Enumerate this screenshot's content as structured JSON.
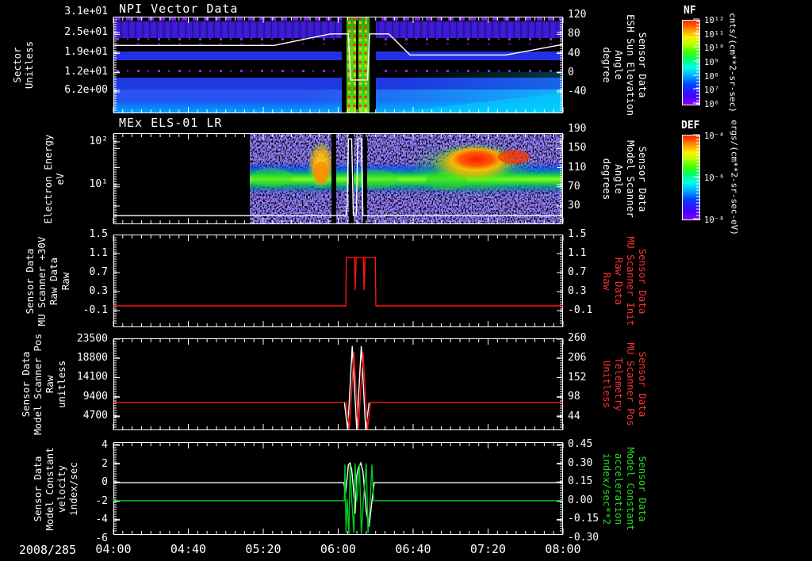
{
  "window": {
    "date_label": "2008/285"
  },
  "xaxis": {
    "tick_labels": [
      "04:00",
      "04:40",
      "05:20",
      "06:00",
      "06:40",
      "07:20",
      "08:00"
    ],
    "t_start": 4,
    "t_end": 8
  },
  "colors": {
    "red": "#ff2020",
    "green": "#00cc33",
    "white": "#ffffff"
  },
  "chart_data": [
    {
      "type": "heatmap",
      "title": "NPI Vector Data",
      "ylabel_lines": [
        "Sector",
        "Unitless"
      ],
      "yticks": [
        "3.1e+01",
        "2.5e+01",
        "1.9e+01",
        "1.2e+01",
        "6.2e+00"
      ],
      "right_axis": {
        "label_lines": [
          "Sensor Data",
          "ESH Sun Elevation",
          "Angle",
          "degree"
        ],
        "ticks": [
          "120",
          "80",
          "40",
          "0",
          "-40"
        ]
      },
      "colorbar": {
        "name": "NF",
        "ticks": [
          "10¹²",
          "10¹¹",
          "10¹⁰",
          "10⁹",
          "10⁸",
          "10⁷",
          "10⁶"
        ],
        "unit": "cnts/(cm**2-sr-sec)"
      },
      "overlay_series": [
        {
          "name": "esh-sun-elevation-angle",
          "color": "#ffffff",
          "axis": "right",
          "points": [
            [
              4.0,
              57
            ],
            [
              5.43,
              57
            ],
            [
              5.93,
              81
            ],
            [
              6.09,
              81
            ],
            [
              6.11,
              -15
            ],
            [
              6.26,
              -15
            ],
            [
              6.28,
              81
            ],
            [
              6.45,
              81
            ],
            [
              6.64,
              37
            ],
            [
              7.49,
              37
            ],
            [
              8.0,
              59
            ]
          ]
        }
      ]
    },
    {
      "type": "heatmap",
      "title": "MEx ELS-01 LR",
      "ylabel_lines": [
        "Electron Energy",
        "eV"
      ],
      "yticks": [
        "10²",
        "10¹"
      ],
      "right_axis": {
        "label_lines": [
          "Sensor Data",
          "Model Scanner",
          "Angle",
          "degrees"
        ],
        "ticks": [
          "190",
          "150",
          "110",
          "70",
          "30"
        ]
      },
      "colorbar": {
        "name": "DEF",
        "ticks": [
          "10⁻⁴",
          "10⁻⁶",
          "10⁻⁸"
        ],
        "unit": "ergs/(cm**2-sr-sec-eV)"
      },
      "overlay_series": [
        {
          "name": "model-scanner-angle",
          "color": "#ffffff",
          "axis": "right",
          "points": [
            [
              4.0,
              10
            ],
            [
              6.07,
              10
            ],
            [
              6.08,
              28
            ],
            [
              6.09,
              170
            ],
            [
              6.12,
              170
            ],
            [
              6.135,
              10
            ],
            [
              6.16,
              10
            ],
            [
              6.175,
              170
            ],
            [
              6.205,
              170
            ],
            [
              6.22,
              10
            ],
            [
              8.0,
              10
            ]
          ]
        }
      ]
    },
    {
      "type": "line",
      "title": "",
      "ylabel_lines": [
        "Sensor Data",
        "MU Scanner +30V",
        "Raw Data",
        "Raw"
      ],
      "yticks": [
        "1.5",
        "1.1",
        "0.7",
        "0.3",
        "-0.1"
      ],
      "right_axis": {
        "label_lines": [
          "Sensor Data",
          "MU Scanner Init",
          "Raw Data",
          "Raw"
        ],
        "label_color": "#ff3030",
        "ticks": [
          "1.5",
          "1.1",
          "0.7",
          "0.3",
          "-0.1"
        ]
      },
      "series": [
        {
          "name": "mu-scanner-30v-raw",
          "color": "#ff1515",
          "axis": "left",
          "points": [
            [
              4.0,
              0.0
            ],
            [
              6.068,
              0.0
            ],
            [
              6.072,
              1.02
            ],
            [
              6.145,
              1.02
            ],
            [
              6.15,
              0.33
            ],
            [
              6.16,
              1.02
            ],
            [
              6.225,
              1.02
            ],
            [
              6.23,
              0.33
            ],
            [
              6.24,
              1.02
            ],
            [
              6.33,
              1.02
            ],
            [
              6.335,
              0.0
            ],
            [
              8.0,
              0.0
            ]
          ]
        }
      ]
    },
    {
      "type": "line",
      "title": "",
      "ylabel_lines": [
        "Sensor Data",
        "Model Scanner Pos",
        "Raw",
        "unitless"
      ],
      "yticks": [
        "23500",
        "18800",
        "14100",
        "9400",
        "4700"
      ],
      "right_axis": {
        "label_lines": [
          "Sensor Data",
          "MU Scanner Pos",
          "Telemetry",
          "Unitless"
        ],
        "label_color": "#ff3030",
        "ticks": [
          "260",
          "206",
          "152",
          "98",
          "44"
        ]
      },
      "series": [
        {
          "name": "model-scanner-pos",
          "color": "#ffffff",
          "axis": "left",
          "points": [
            [
              6.055,
              8000
            ],
            [
              6.085,
              1300
            ],
            [
              6.125,
              21800
            ],
            [
              6.165,
              1300
            ],
            [
              6.205,
              21800
            ],
            [
              6.245,
              1300
            ],
            [
              6.275,
              8000
            ]
          ]
        },
        {
          "name": "mu-scanner-pos-telemetry",
          "color": "#ff1515",
          "axis": "left",
          "points": [
            [
              4.0,
              8000
            ],
            [
              6.07,
              8000
            ],
            [
              6.1,
              1500
            ],
            [
              6.14,
              20300
            ],
            [
              6.18,
              1500
            ],
            [
              6.22,
              20300
            ],
            [
              6.26,
              1500
            ],
            [
              6.29,
              8000
            ],
            [
              8.0,
              8000
            ]
          ]
        }
      ]
    },
    {
      "type": "line",
      "title": "",
      "ylabel_lines": [
        "Sensor Data",
        "Model Constant",
        "velocity",
        "index/sec"
      ],
      "yticks": [
        "4",
        "2",
        "0",
        "-2",
        "-4",
        "-6"
      ],
      "right_axis": {
        "label_lines": [
          "Sensor Data",
          "Model Constant",
          "acceleration",
          "index/sec**2"
        ],
        "label_color": "#22dd22",
        "ticks": [
          "0.45",
          "0.30",
          "0.15",
          "0.00",
          "-0.15",
          "-0.30"
        ]
      },
      "series": [
        {
          "name": "model-constant-velocity",
          "color": "#ffffff",
          "axis": "left",
          "points": [
            [
              4.0,
              0
            ],
            [
              6.05,
              0
            ],
            [
              6.065,
              -1.2
            ],
            [
              6.08,
              0.5
            ],
            [
              6.09,
              1.9
            ],
            [
              6.105,
              2.1
            ],
            [
              6.12,
              1.4
            ],
            [
              6.135,
              -0.5
            ],
            [
              6.15,
              -3.3
            ],
            [
              6.165,
              0.8
            ],
            [
              6.18,
              1.6
            ],
            [
              6.2,
              2.1
            ],
            [
              6.22,
              1.2
            ],
            [
              6.235,
              -0.8
            ],
            [
              6.25,
              -3.1
            ],
            [
              6.275,
              -4.7
            ],
            [
              6.3,
              -2.0
            ],
            [
              6.32,
              0
            ],
            [
              8.0,
              0
            ]
          ]
        },
        {
          "name": "model-constant-acceleration",
          "color": "#00cc22",
          "axis": "right",
          "points": [
            [
              4.0,
              0
            ],
            [
              6.055,
              0
            ],
            [
              6.06,
              0.29
            ],
            [
              6.07,
              -0.26
            ],
            [
              6.08,
              0.01
            ],
            [
              6.095,
              -0.27
            ],
            [
              6.105,
              0.29
            ],
            [
              6.12,
              0.01
            ],
            [
              6.14,
              -0.26
            ],
            [
              6.15,
              0.3
            ],
            [
              6.165,
              -0.01
            ],
            [
              6.19,
              0.29
            ],
            [
              6.205,
              -0.27
            ],
            [
              6.225,
              0.01
            ],
            [
              6.25,
              0.3
            ],
            [
              6.265,
              -0.26
            ],
            [
              6.285,
              0.01
            ],
            [
              6.3,
              0.29
            ],
            [
              6.315,
              0
            ],
            [
              8.0,
              0
            ]
          ]
        }
      ]
    }
  ]
}
